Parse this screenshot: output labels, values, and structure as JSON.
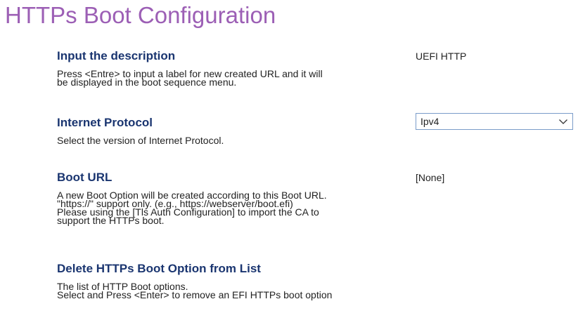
{
  "page": {
    "title": "HTTPs Boot Configuration"
  },
  "items": [
    {
      "title": "Input the description",
      "value": "UEFI HTTP",
      "help": [
        "Press <Entre> to input a label for new created URL and it will",
        "be displayed in the boot sequence menu."
      ]
    },
    {
      "title": "Internet Protocol",
      "selected": "Ipv4",
      "help": [
        "Select the version of Internet Protocol."
      ]
    },
    {
      "title": "Boot URL",
      "value": "[None]",
      "help": [
        "A new Boot Option will be created according to this Boot URL.",
        "\"https://\" support only. (e.g., https://webserver/boot.efi)",
        "Please using the  [Tls Auth Configuration] to import the CA to",
        "support the HTTPs boot."
      ]
    },
    {
      "title": "Delete HTTPs Boot Option from List",
      "help": [
        "The list of HTTP Boot options.",
        "Select and Press <Enter> to remove an EFI HTTPs boot option"
      ]
    }
  ],
  "colors": {
    "title": "#9c5fb5",
    "heading": "#1a3570",
    "text": "#222222",
    "select_border": "#7a9cc9"
  },
  "icons": {
    "select_chevron": "chevron-down-icon"
  }
}
